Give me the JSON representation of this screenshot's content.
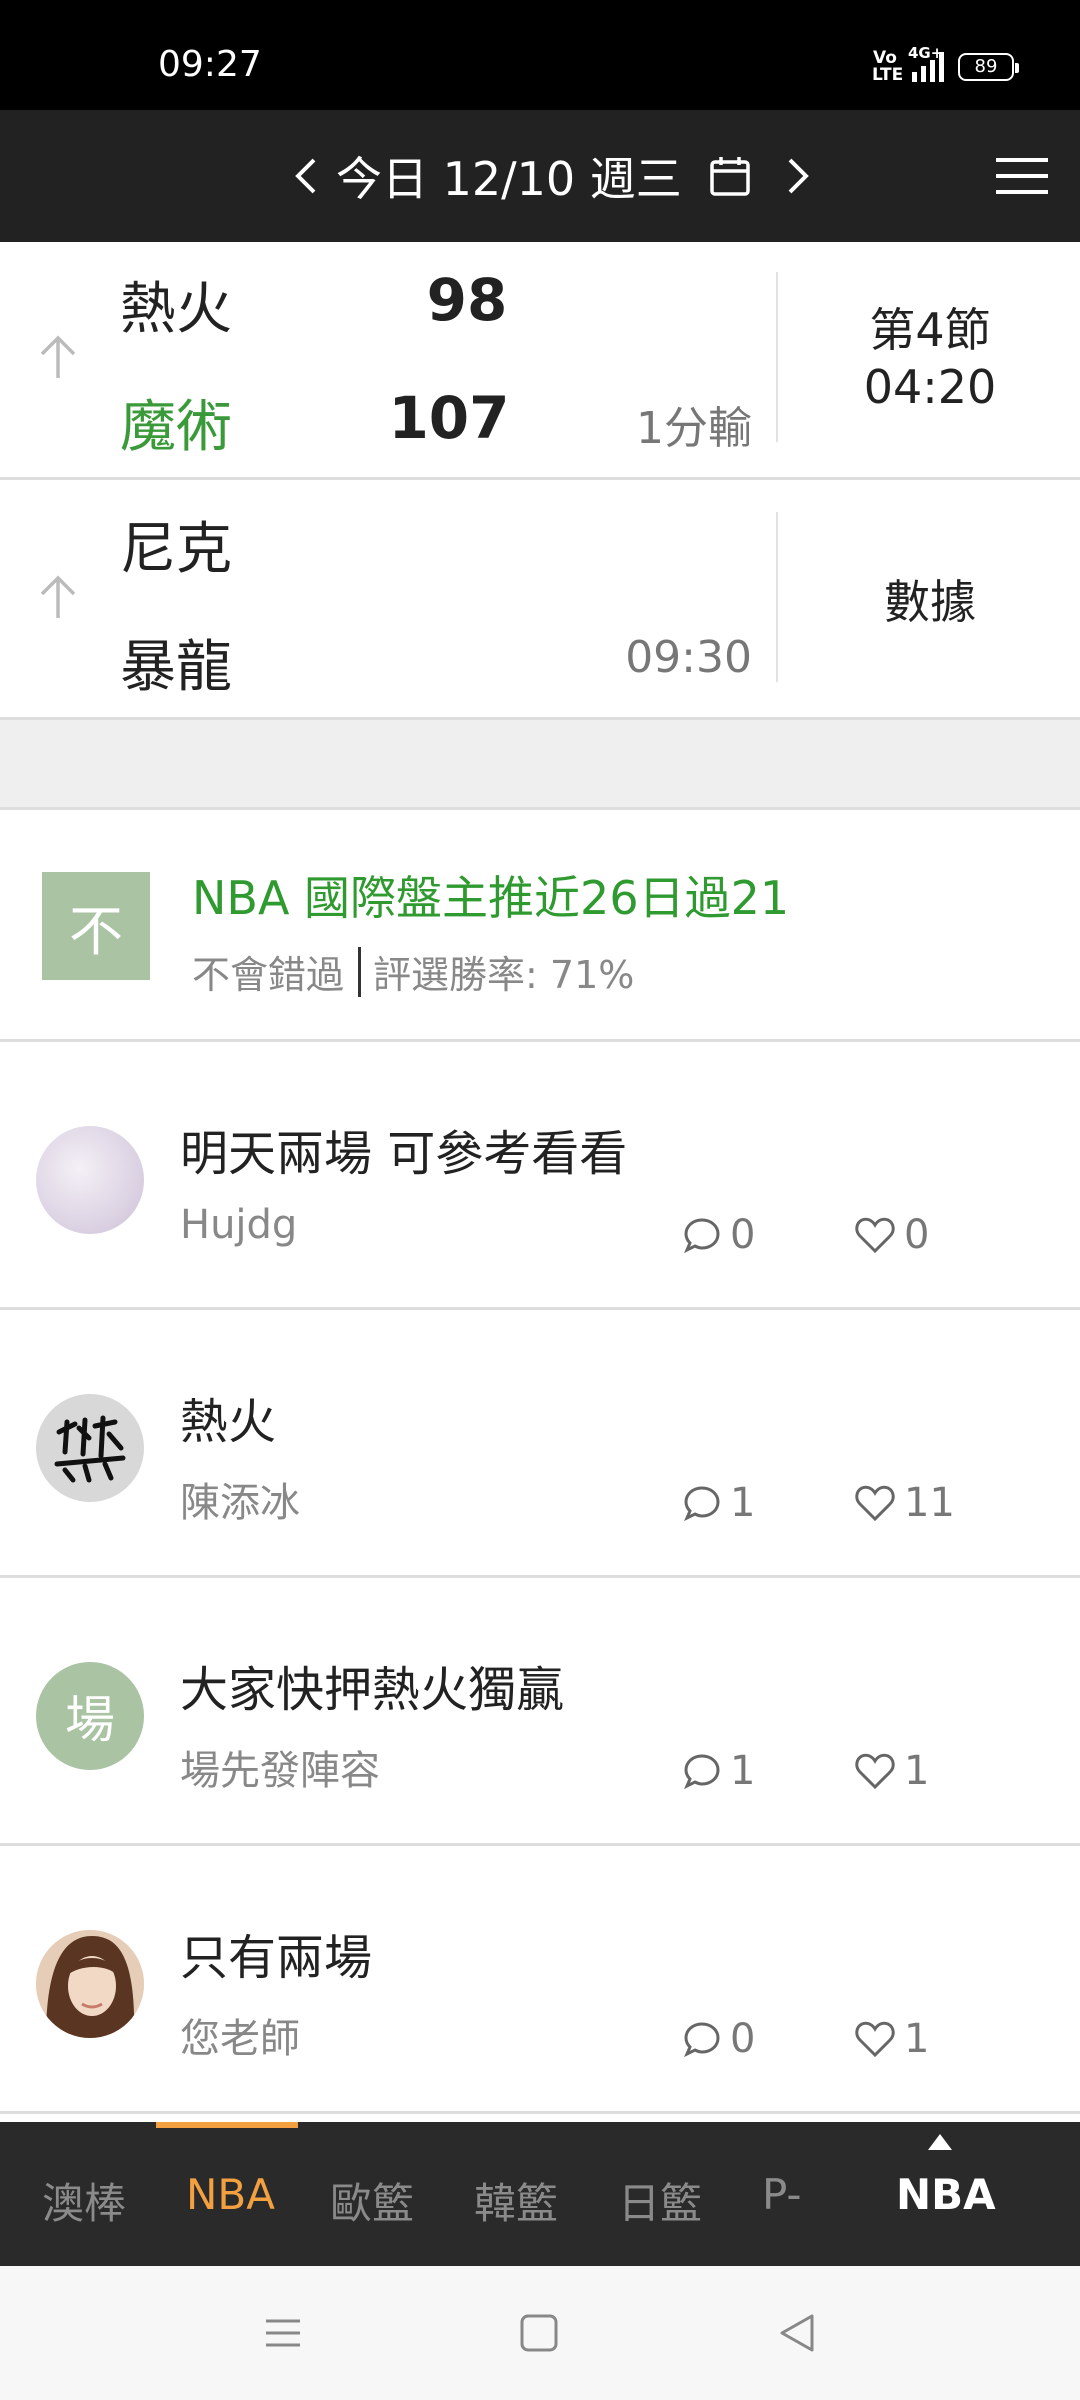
{
  "status": {
    "time": "09:27",
    "volte": "Vo\nLTE",
    "network": "4G+",
    "battery": "89"
  },
  "header": {
    "date_label": "今日 12/10 週三"
  },
  "games": [
    {
      "team1": "熱火",
      "score1": "98",
      "team2": "魔術",
      "score2": "107",
      "note": "1分輸",
      "period": "第4節",
      "clock": "04:20"
    },
    {
      "team1": "尼克",
      "team2": "暴龍",
      "time": "09:30",
      "side": "數據"
    }
  ],
  "pick": {
    "avatar_letter": "不",
    "title": "NBA 國際盤主推近26日過21",
    "author": "不會錯過",
    "rate": "評選勝率: 71%"
  },
  "posts": [
    {
      "title": "明天兩場 可參考看看",
      "author": "Hujdg",
      "comments": "0",
      "likes": "0"
    },
    {
      "title": "熱火",
      "author": "陳添冰",
      "comments": "1",
      "likes": "11"
    },
    {
      "title": "大家快押熱火獨贏",
      "author": "場先發陣容",
      "avatar_letter": "場",
      "comments": "1",
      "likes": "1"
    },
    {
      "title": "只有兩場",
      "author": "您老師",
      "comments": "0",
      "likes": "1"
    }
  ],
  "tabs": {
    "items": [
      "澳棒",
      "NBA",
      "歐籃",
      "韓籃",
      "日籃",
      "P-"
    ],
    "active": "NBA",
    "current": "NBA"
  },
  "colors": {
    "accent": "#f2a040",
    "green": "#3a9a3a",
    "header_bg": "#222222"
  }
}
